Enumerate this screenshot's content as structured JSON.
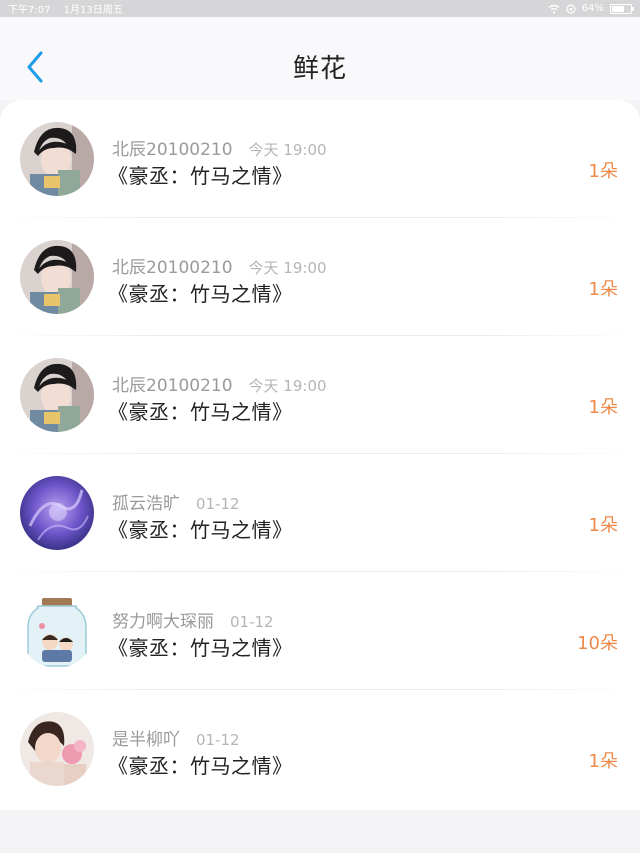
{
  "status_bar": {
    "time": "下午7:07",
    "date": "1月13日周五",
    "battery": "64%",
    "battery_level": 0.64,
    "icons": [
      "wifi-icon",
      "lock-rotation-icon",
      "battery-icon"
    ]
  },
  "header": {
    "title": "鲜花",
    "back_icon": "chevron-left-icon"
  },
  "colors": {
    "accent_blue": "#1e9bea",
    "count_orange": "#ef8a4a",
    "name_gray": "#9a9a9a"
  },
  "items": [
    {
      "name": "北辰20100210",
      "time": "今天 19:00",
      "book": "《豪丞：竹马之情》",
      "count": "1朵",
      "avatar": "boy-photo"
    },
    {
      "name": "北辰20100210",
      "time": "今天 19:00",
      "book": "《豪丞：竹马之情》",
      "count": "1朵",
      "avatar": "boy-photo"
    },
    {
      "name": "北辰20100210",
      "time": "今天 19:00",
      "book": "《豪丞：竹马之情》",
      "count": "1朵",
      "avatar": "boy-photo"
    },
    {
      "name": "孤云浩旷",
      "time": "01-12",
      "book": "《豪丞：竹马之情》",
      "count": "1朵",
      "avatar": "purple-abstract"
    },
    {
      "name": "努力啊大琛丽",
      "time": "01-12",
      "book": "《豪丞：竹马之情》",
      "count": "10朵",
      "avatar": "jar-illustration"
    },
    {
      "name": "是半柳吖",
      "time": "01-12",
      "book": "《豪丞：竹马之情》",
      "count": "1朵",
      "avatar": "child-photo"
    }
  ]
}
